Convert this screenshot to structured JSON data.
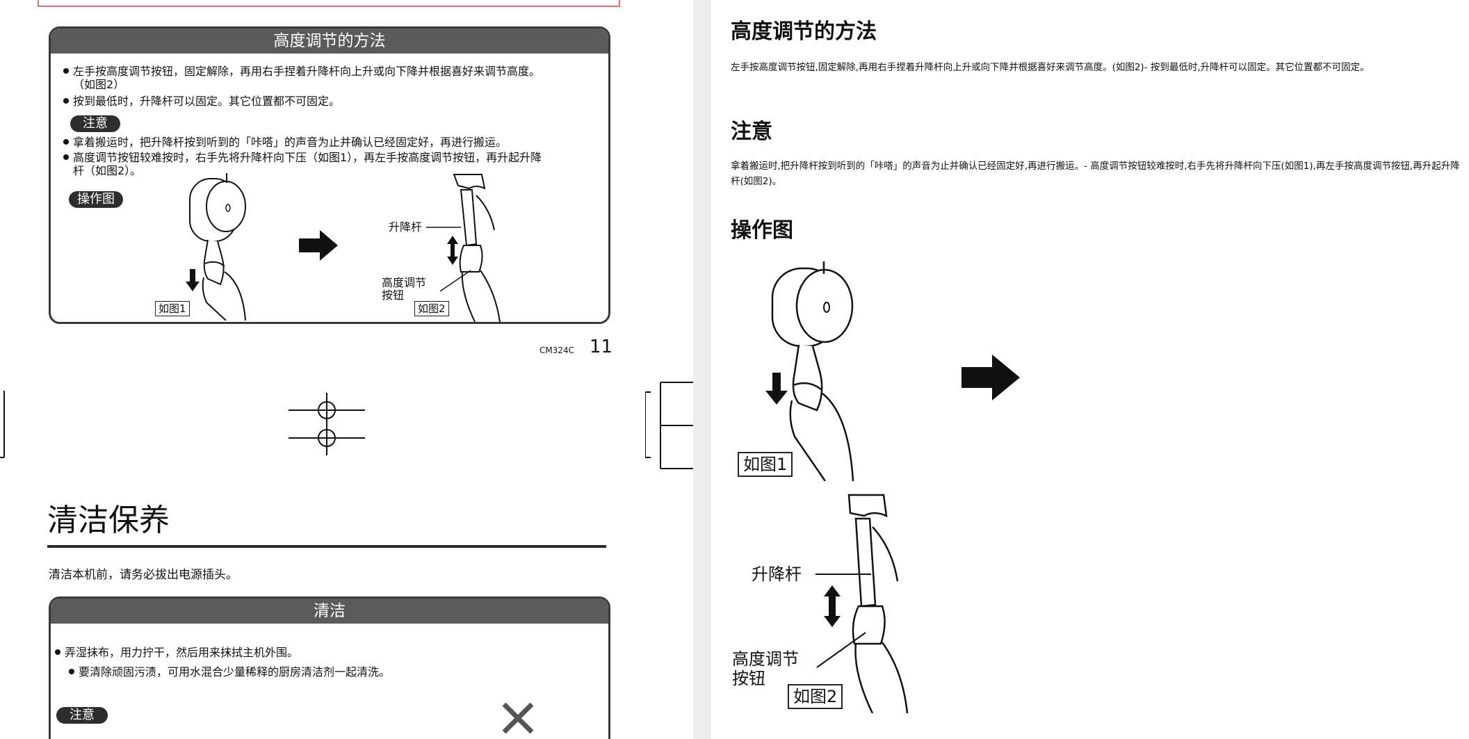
{
  "left": {
    "panel1": {
      "title": "高度调节的方法",
      "bullet1": "左手按高度调节按钮，固定解除，再用右手捏着升降杆向上升或向下降并根据喜好来调节高度。",
      "bullet1_cont": "（如图2）",
      "bullet2": "按到最低时，升降杆可以固定。其它位置都不可固定。",
      "caution_label": "注意",
      "caution1": "拿着搬运时，把升降杆按到听到的「咔嗒」的声音为止并确认已经固定好，再进行搬运。",
      "caution2": "高度调节按钮较难按时，右手先将升降杆向下压（如图1），再左手按高度调节按钮，再升起升降",
      "caution2_cont": "杆（如图2）。",
      "figure_label": "操作图",
      "fig1_label": "如图1",
      "fig2_label": "如图2",
      "lift_rod_label": "升降杆",
      "button_label_1": "高度调节",
      "button_label_2": "按钮"
    },
    "page_code": "CM324C",
    "page_number": "11",
    "section_title": "清洁保养",
    "section_intro": "清洁本机前，请务必拔出电源插头。",
    "panel2": {
      "title": "清洁",
      "bullet1": "弄湿抹布，用力拧干，然后用来抹拭主机外围。",
      "sub_bullet": "要清除顽固污渍，可用水混合少量稀释的厨房清洁剂一起清洗。",
      "caution_label": "注意"
    }
  },
  "right": {
    "heading1": "高度调节的方法",
    "para1": "左手按高度调节按钮,固定解除,再用右手捏着升降杆向上升或向下降并根据喜好来调节高度。(如图2)- 按到最低时,升降杆可以固定。其它位置都不可固定。",
    "heading2": "注意",
    "para2": "拿着搬运时,把升降杆按到听到的「咔嗒」的声音为止并确认已经固定好,再进行搬运。- 高度调节按钮较难按时,右手先将升降杆向下压(如图1),再左手按高度调节按钮,再升起升降杆(如图2)。",
    "heading3": "操作图",
    "fig1_label": "如图1",
    "fig2_label": "如图2",
    "lift_rod_label": "升降杆",
    "button_label_1": "高度调节",
    "button_label_2": "按钮"
  },
  "colors": {
    "panel_header": "#5b5b5b",
    "pill": "#2e2e2e",
    "red_frame": "#e26b6b"
  }
}
